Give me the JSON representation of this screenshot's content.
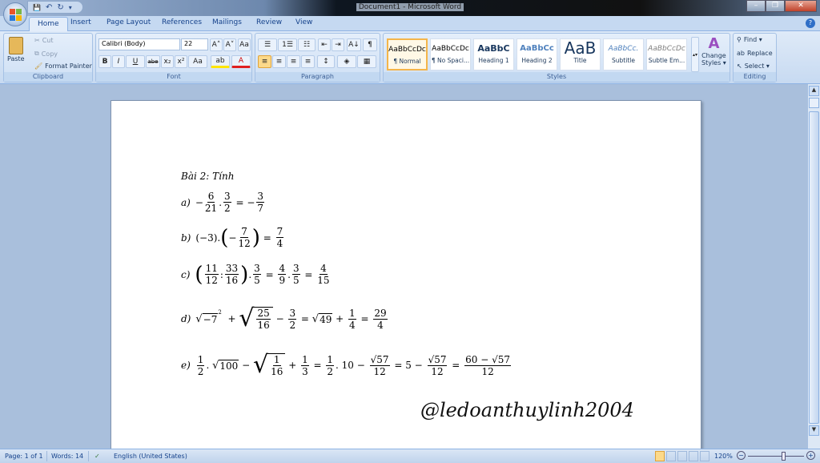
{
  "window": {
    "title": "Document1 - Microsoft Word",
    "minimize": "–",
    "restore": "❐",
    "close": "✕"
  },
  "qat": {
    "save": "💾",
    "undo": "↶",
    "redo": "↻",
    "customize": "▾"
  },
  "tabs": [
    "Home",
    "Insert",
    "Page Layout",
    "References",
    "Mailings",
    "Review",
    "View"
  ],
  "help": "?",
  "clipboard": {
    "paste": "Paste",
    "cut": "Cut",
    "copy": "Copy",
    "format_painter": "Format Painter",
    "label": "Clipboard"
  },
  "font": {
    "name": "Calibri (Body)",
    "size": "22",
    "grow": "A˄",
    "shrink": "A˅",
    "clear": "Aa",
    "bold": "B",
    "italic": "I",
    "underline": "U",
    "strike": "abe",
    "sub": "x₂",
    "sup": "x²",
    "case": "Aa",
    "highlight": "ab",
    "color": "A",
    "label": "Font"
  },
  "paragraph": {
    "bullets": "☰",
    "numbering": "1☰",
    "multilevel": "☷",
    "dec_indent": "⇤",
    "inc_indent": "⇥",
    "sort": "A↓",
    "pilcrow": "¶",
    "align_left": "≡",
    "center": "≡",
    "align_right": "≡",
    "justify": "≡",
    "line_spacing": "↕",
    "shading": "◈",
    "borders": "▦",
    "label": "Paragraph"
  },
  "styles": {
    "items": [
      {
        "preview": "AaBbCcDc",
        "name": "¶ Normal"
      },
      {
        "preview": "AaBbCcDc",
        "name": "¶ No Spaci..."
      },
      {
        "preview": "AaBbC",
        "name": "Heading 1"
      },
      {
        "preview": "AaBbCc",
        "name": "Heading 2"
      },
      {
        "preview": "AaB",
        "name": "Title"
      },
      {
        "preview": "AaBbCc.",
        "name": "Subtitle"
      },
      {
        "preview": "AaBbCcDc",
        "name": "Subtle Em..."
      }
    ],
    "change_line1": "Change",
    "change_line2": "Styles ▾",
    "label": "Styles"
  },
  "editing": {
    "find": "Find ▾",
    "replace": "Replace",
    "select": "Select ▾",
    "label": "Editing"
  },
  "document": {
    "heading": "Bài 2: Tính",
    "lines": [
      {
        "label": "a)",
        "tokens": [
          {
            "t": "txt",
            "v": "−"
          },
          {
            "t": "frac",
            "n": "6",
            "d": "21"
          },
          {
            "t": "txt",
            "v": "."
          },
          {
            "t": "frac",
            "n": "3",
            "d": "2"
          },
          {
            "t": "txt",
            "v": " = −"
          },
          {
            "t": "frac",
            "n": "3",
            "d": "7"
          }
        ]
      },
      {
        "label": "b)",
        "tokens": [
          {
            "t": "txt",
            "v": "(−3)."
          },
          {
            "t": "paren",
            "v": "("
          },
          {
            "t": "txt",
            "v": "−"
          },
          {
            "t": "frac",
            "n": "7",
            "d": "12"
          },
          {
            "t": "paren",
            "v": ")"
          },
          {
            "t": "txt",
            "v": " = "
          },
          {
            "t": "frac",
            "n": "7",
            "d": "4"
          }
        ]
      },
      {
        "label": "c)",
        "tokens": [
          {
            "t": "paren",
            "v": "("
          },
          {
            "t": "frac",
            "n": "11",
            "d": "12"
          },
          {
            "t": "txt",
            "v": ":"
          },
          {
            "t": "frac",
            "n": "33",
            "d": "16"
          },
          {
            "t": "paren",
            "v": ")"
          },
          {
            "t": "txt",
            "v": "."
          },
          {
            "t": "frac",
            "n": "3",
            "d": "5"
          },
          {
            "t": "txt",
            "v": " = "
          },
          {
            "t": "frac",
            "n": "4",
            "d": "9"
          },
          {
            "t": "txt",
            "v": "."
          },
          {
            "t": "frac",
            "n": "3",
            "d": "5"
          },
          {
            "t": "txt",
            "v": " = "
          },
          {
            "t": "frac",
            "n": "4",
            "d": "15"
          }
        ]
      },
      {
        "label": "d)",
        "tokens": [
          {
            "t": "sqrt",
            "v": "−7"
          },
          {
            "t": "sup",
            "v": "2"
          },
          {
            "t": "txt",
            "v": "  + "
          },
          {
            "t": "sqrtfrac",
            "n": "25",
            "d": "16"
          },
          {
            "t": "txt",
            "v": " − "
          },
          {
            "t": "frac",
            "n": "3",
            "d": "2"
          },
          {
            "t": "txt",
            "v": " = "
          },
          {
            "t": "sqrt",
            "v": "49"
          },
          {
            "t": "txt",
            "v": " + "
          },
          {
            "t": "frac",
            "n": "1",
            "d": "4"
          },
          {
            "t": "txt",
            "v": " = "
          },
          {
            "t": "frac",
            "n": "29",
            "d": "4"
          }
        ]
      },
      {
        "label": "e)",
        "tokens": [
          {
            "t": "frac",
            "n": "1",
            "d": "2"
          },
          {
            "t": "txt",
            "v": ". "
          },
          {
            "t": "sqrt",
            "v": "100"
          },
          {
            "t": "txt",
            "v": " − "
          },
          {
            "t": "sqrtfrac",
            "n": "1",
            "d": "16"
          },
          {
            "t": "txt",
            "v": " + "
          },
          {
            "t": "frac",
            "n": "1",
            "d": "3"
          },
          {
            "t": "txt",
            "v": " = "
          },
          {
            "t": "frac",
            "n": "1",
            "d": "2"
          },
          {
            "t": "txt",
            "v": ". 10 − "
          },
          {
            "t": "frac",
            "n": "√57",
            "d": "12"
          },
          {
            "t": "txt",
            "v": " = 5 − "
          },
          {
            "t": "frac",
            "n": "√57",
            "d": "12"
          },
          {
            "t": "txt",
            "v": " = "
          },
          {
            "t": "frac",
            "n": "60 − √57",
            "d": "12"
          }
        ]
      }
    ],
    "watermark": "@ledoanthuylinh2004"
  },
  "status": {
    "page": "Page: 1 of 1",
    "words": "Words: 14",
    "proofing": "✓",
    "language": "English (United States)",
    "zoom": "120%",
    "zoom_minus": "−",
    "zoom_plus": "+"
  },
  "zoom_level_percent": 120
}
